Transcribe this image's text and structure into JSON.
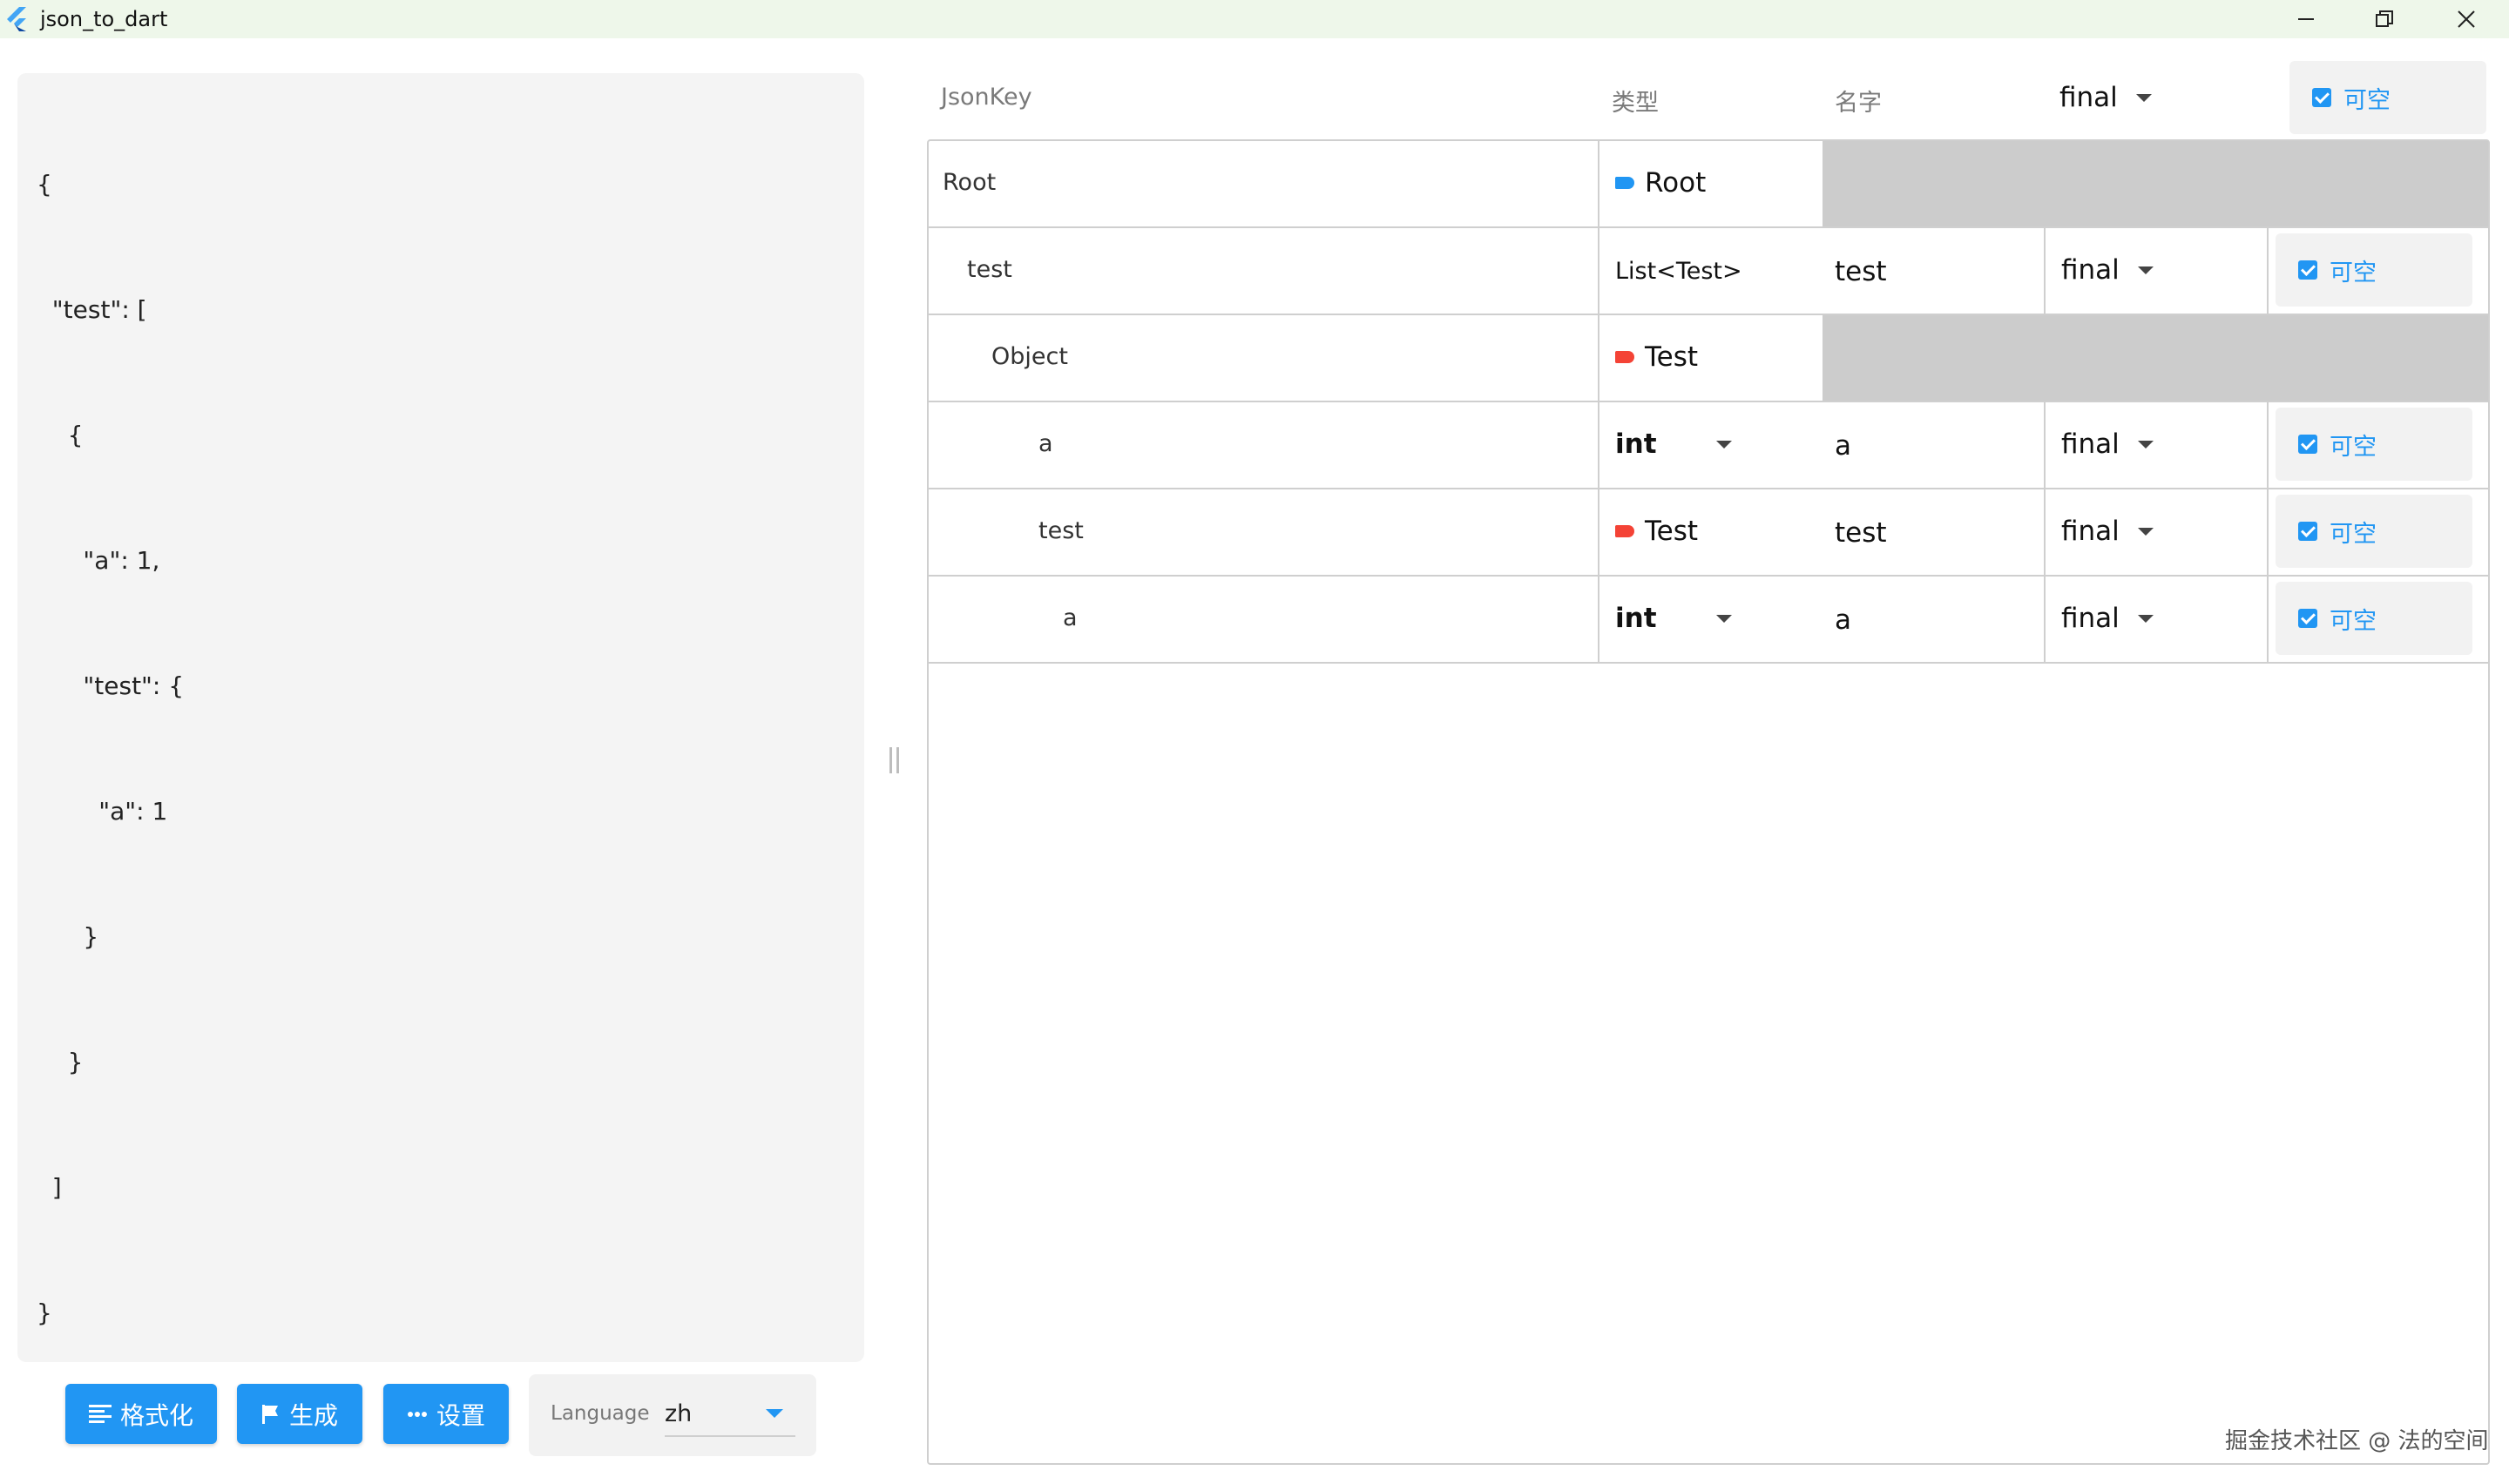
{
  "window": {
    "title": "json_to_dart",
    "controls": [
      "minimize-icon",
      "restore-icon",
      "close-icon"
    ]
  },
  "editor": {
    "lines": [
      "{",
      "  \"test\": [",
      "    {",
      "      \"a\": 1,",
      "      \"test\": {",
      "        \"a\": 1",
      "      }",
      "    }",
      "  ]",
      "}"
    ]
  },
  "toolbar": {
    "format_label": "格式化",
    "generate_label": "生成",
    "settings_label": "设置",
    "language_label": "Language",
    "language_value": "zh"
  },
  "table": {
    "headers": {
      "jsonkey": "JsonKey",
      "type": "类型",
      "name": "名字",
      "final": "final",
      "nullable": "可空"
    },
    "rows": [
      {
        "key": "Root",
        "type": "Root",
        "type_tag_color": "#2196f3"
      },
      {
        "key": "test",
        "type": "List<Test>",
        "name": "test",
        "modifier": "final",
        "nullable": "可空"
      },
      {
        "key": "Object",
        "type": "Test",
        "type_tag_color": "#f44336"
      },
      {
        "key": "a",
        "type": "int",
        "name": "a",
        "modifier": "final",
        "nullable": "可空"
      },
      {
        "key": "test",
        "type": "Test",
        "type_tag_color": "#f44336",
        "name": "test",
        "modifier": "final",
        "nullable": "可空"
      },
      {
        "key": "a",
        "type": "int",
        "name": "a",
        "modifier": "final",
        "nullable": "可空"
      }
    ]
  },
  "watermark": "掘金技术社区 @ 法的空间",
  "colors": {
    "accent": "#2196f3",
    "tag_red": "#f44336",
    "class_row_fill": "#cccccc"
  }
}
